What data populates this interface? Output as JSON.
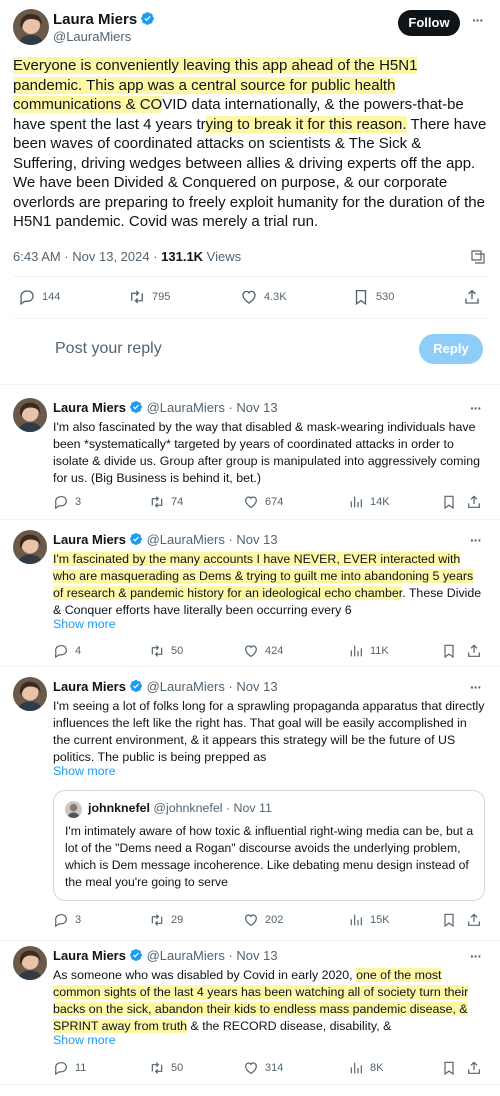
{
  "main": {
    "name": "Laura Miers",
    "handle": "@LauraMiers",
    "follow_label": "Follow",
    "text_hl1": "Everyone is conveniently leaving this app ahead of the H5N1 pandemic. This app was a central source for public health communications & CO",
    "text_p1": "VID data internationally, & the powers-that-be have spent the last 4 y",
    "text_p2": "ears tr",
    "text_hl2": "ying to break it for this reason.",
    "text_p3": " There have been waves of coordinated attacks on scientists & The Sick & Suffering, driving wedges between allies & driving experts off the app. We have been Divided & Conquered on purpose, & our corporate overlords are preparing to freely exploit humanity for the duration of the H5N1 pandemic. Covid was merely a trial run.",
    "timestamp": "6:43 AM · Nov 13, 2024 · ",
    "views_count": "131.1K",
    "views_label": " Views",
    "replies": "144",
    "reposts": "795",
    "likes": "4.3K",
    "bookmarks": "530",
    "reply_placeholder": "Post your reply",
    "reply_button": "Reply"
  },
  "replies": [
    {
      "name": "Laura Miers",
      "handle": "@LauraMiers",
      "date": "Nov 13",
      "text": "I'm also fascinated by the way that disabled & mask-wearing individuals have been *systematically* targeted by years of coordinated attacks in order to isolate & divide us. Group after group is manipulated into aggressively coming for us. (Big Business is behind it, bet.)",
      "replies": "3",
      "reposts": "74",
      "likes": "674",
      "views": "14K"
    },
    {
      "name": "Laura Miers",
      "handle": "@LauraMiers",
      "date": "Nov 13",
      "text_hl": "I'm fascinated by the many accounts I have NEVER, EVER interacted with who are masquerading as Dems & trying to guilt me into abandoning 5 ye",
      "text_hl_b": "ars of research & pandemic history for an ideological echo chamber",
      "text_rest": ". These Divide & Conquer efforts have literally been occurring every 6",
      "show_more": "Show more",
      "replies": "4",
      "reposts": "50",
      "likes": "424",
      "views": "11K"
    },
    {
      "name": "Laura Miers",
      "handle": "@LauraMiers",
      "date": "Nov 13",
      "text": "I'm seeing a lot of folks long for a sprawling propaganda apparatus that directly influences the left like the right has. That goal will be easily accomplished in the current environment, & it appears this strategy will be the future of US politics. The public is being prepped as",
      "show_more": "Show more",
      "quote": {
        "name": "johnknefel",
        "handle": "@johnknefel",
        "date": "Nov 11",
        "text": "I'm intimately aware of how toxic & influential right-wing media can be, but a lot of the \"Dems need a Rogan\" discourse avoids the underlying problem, which is Dem message incoherence. Like debating menu design instead of the meal you're going to serve"
      },
      "replies": "3",
      "reposts": "29",
      "likes": "202",
      "views": "15K"
    },
    {
      "name": "Laura Miers",
      "handle": "@LauraMiers",
      "date": "Nov 13",
      "text_pre": "As someone who was disabled by Covid in early 2020, ",
      "text_hl": "one of the most common sights of the last 4 years has been watching all of society turn their backs on the sick, abandon their kids to endless mass pandemic disease, & SPRINT away from truth",
      "text_rest": " & the RECORD disease, disability, &",
      "show_more": "Show more",
      "replies": "11",
      "reposts": "50",
      "likes": "314",
      "views": "8K"
    }
  ]
}
